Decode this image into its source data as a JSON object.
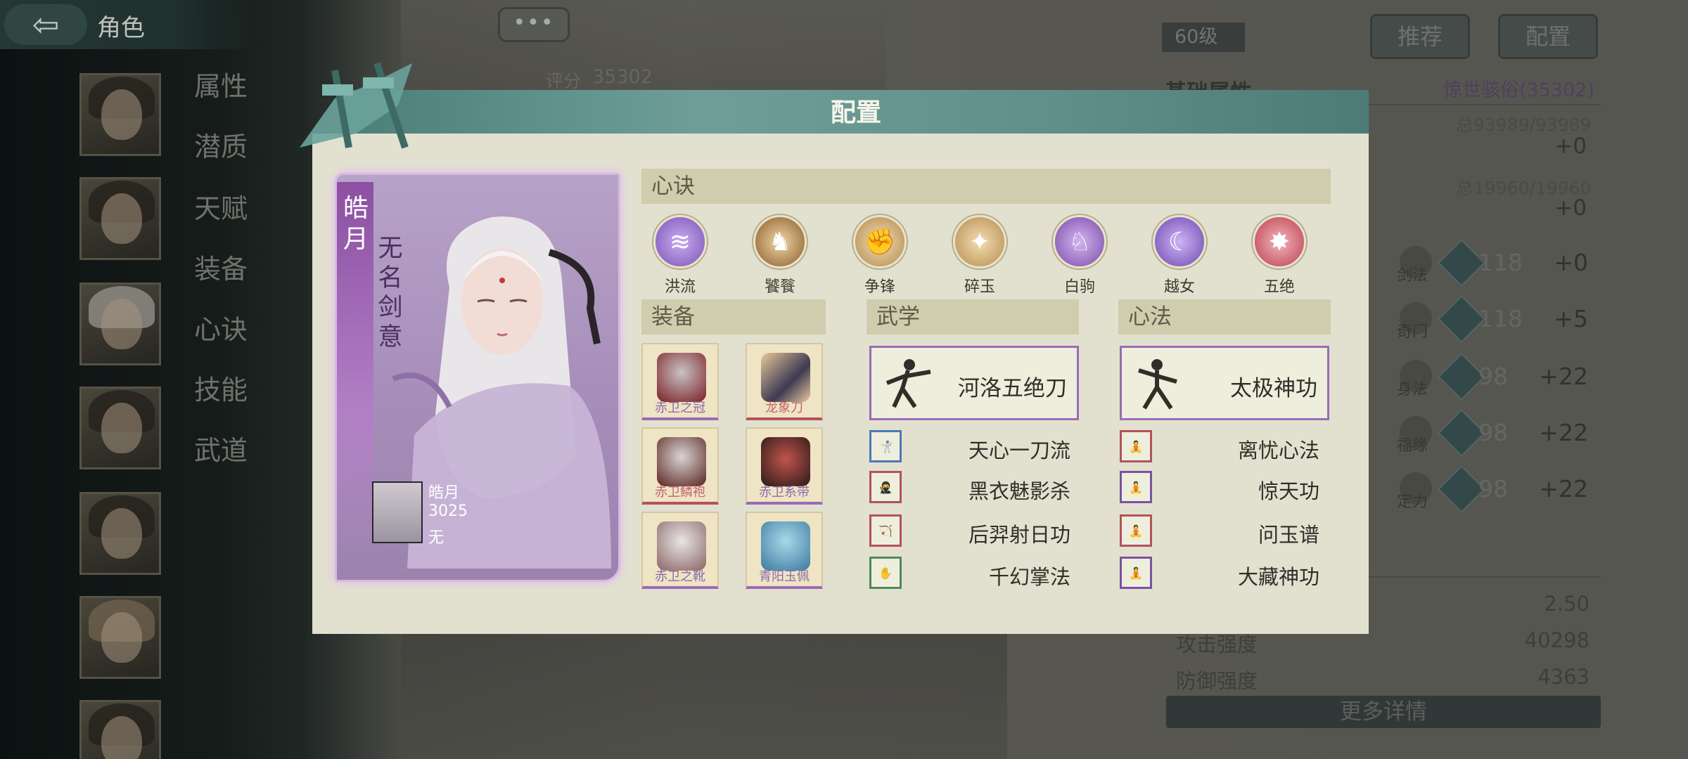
{
  "header": {
    "screen_title": "角色"
  },
  "side_menu": [
    "属性",
    "潜质",
    "天赋",
    "装备",
    "心诀",
    "技能",
    "武道"
  ],
  "background": {
    "chat_bubble": "•••",
    "score_label": "评分",
    "score_value": "35302",
    "level": "60级",
    "recommend_button": "推荐",
    "config_button": "配置",
    "section_title": "基础属性",
    "quality": "惊世骇俗(35302)",
    "hp_total": "总93989/93989",
    "hp_bonus": "+0",
    "mp_total": "总19960/19960",
    "mp_bonus": "+0",
    "attributes": [
      {
        "name": "剑法",
        "base": "118",
        "bonus": "+0"
      },
      {
        "name": "奇门",
        "base": "118",
        "bonus": "+5"
      },
      {
        "name": "身法",
        "base": "98",
        "bonus": "+22"
      },
      {
        "name": "福缘",
        "base": "98",
        "bonus": "+22"
      },
      {
        "name": "定力",
        "base": "98",
        "bonus": "+22"
      }
    ],
    "stats": [
      {
        "label": "",
        "value": "2.50"
      },
      {
        "label": "攻击强度",
        "value": "40298"
      },
      {
        "label": "防御强度",
        "value": "4363"
      }
    ],
    "more_details": "更多详情"
  },
  "modal": {
    "title": "配置",
    "character": {
      "name": "皓月",
      "title": "无名剑意",
      "mini_name": "皓月",
      "mini_power": "3025",
      "mini_extra": "无"
    },
    "sections": {
      "xinjue": "心诀",
      "equipment": "装备",
      "wuxue": "武学",
      "xinfa": "心法"
    },
    "xinjue_items": [
      {
        "label": "洪流",
        "color": "#7a52b5",
        "glyph": "≋"
      },
      {
        "label": "饕餮",
        "color": "#b98a4a",
        "glyph": "♞"
      },
      {
        "label": "争锋",
        "color": "#c39a5a",
        "glyph": "✊"
      },
      {
        "label": "碎玉",
        "color": "#c59a5c",
        "glyph": "✦"
      },
      {
        "label": "白驹",
        "color": "#8a5bb8",
        "glyph": "♘"
      },
      {
        "label": "越女",
        "color": "#8256bb",
        "glyph": "☾"
      },
      {
        "label": "五绝",
        "color": "#c65566",
        "glyph": "✸"
      }
    ],
    "equipment": [
      {
        "name": "赤卫之冠",
        "rarity": "purple",
        "art_color": "#7a1f26"
      },
      {
        "name": "龙象刀",
        "rarity": "red",
        "art_color": "#3d3a52"
      },
      {
        "name": "赤卫鳞袍",
        "rarity": "red",
        "art_color": "#5a2420"
      },
      {
        "name": "赤卫系带",
        "rarity": "purple",
        "art_color": "#6b2020"
      },
      {
        "name": "赤卫之靴",
        "rarity": "purple",
        "art_color": "#9a8a8a"
      },
      {
        "name": "青阳玉佩",
        "rarity": "purple",
        "art_color": "#3c7aa0"
      }
    ],
    "wuxue": {
      "main": "河洛五绝刀",
      "subs": [
        {
          "name": "天心一刀流",
          "border": "#4b79b4"
        },
        {
          "name": "黑衣魅影杀",
          "border": "#b3525a"
        },
        {
          "name": "后羿射日功",
          "border": "#b3525a"
        },
        {
          "name": "千幻掌法",
          "border": "#4f8a5a"
        }
      ]
    },
    "xinfa": {
      "main": "太极神功",
      "subs": [
        {
          "name": "离忧心法",
          "border": "#b3525a"
        },
        {
          "name": "惊天功",
          "border": "#7a52a0"
        },
        {
          "name": "问玉谱",
          "border": "#b3525a"
        },
        {
          "name": "大藏神功",
          "border": "#7a52a0"
        }
      ]
    }
  }
}
